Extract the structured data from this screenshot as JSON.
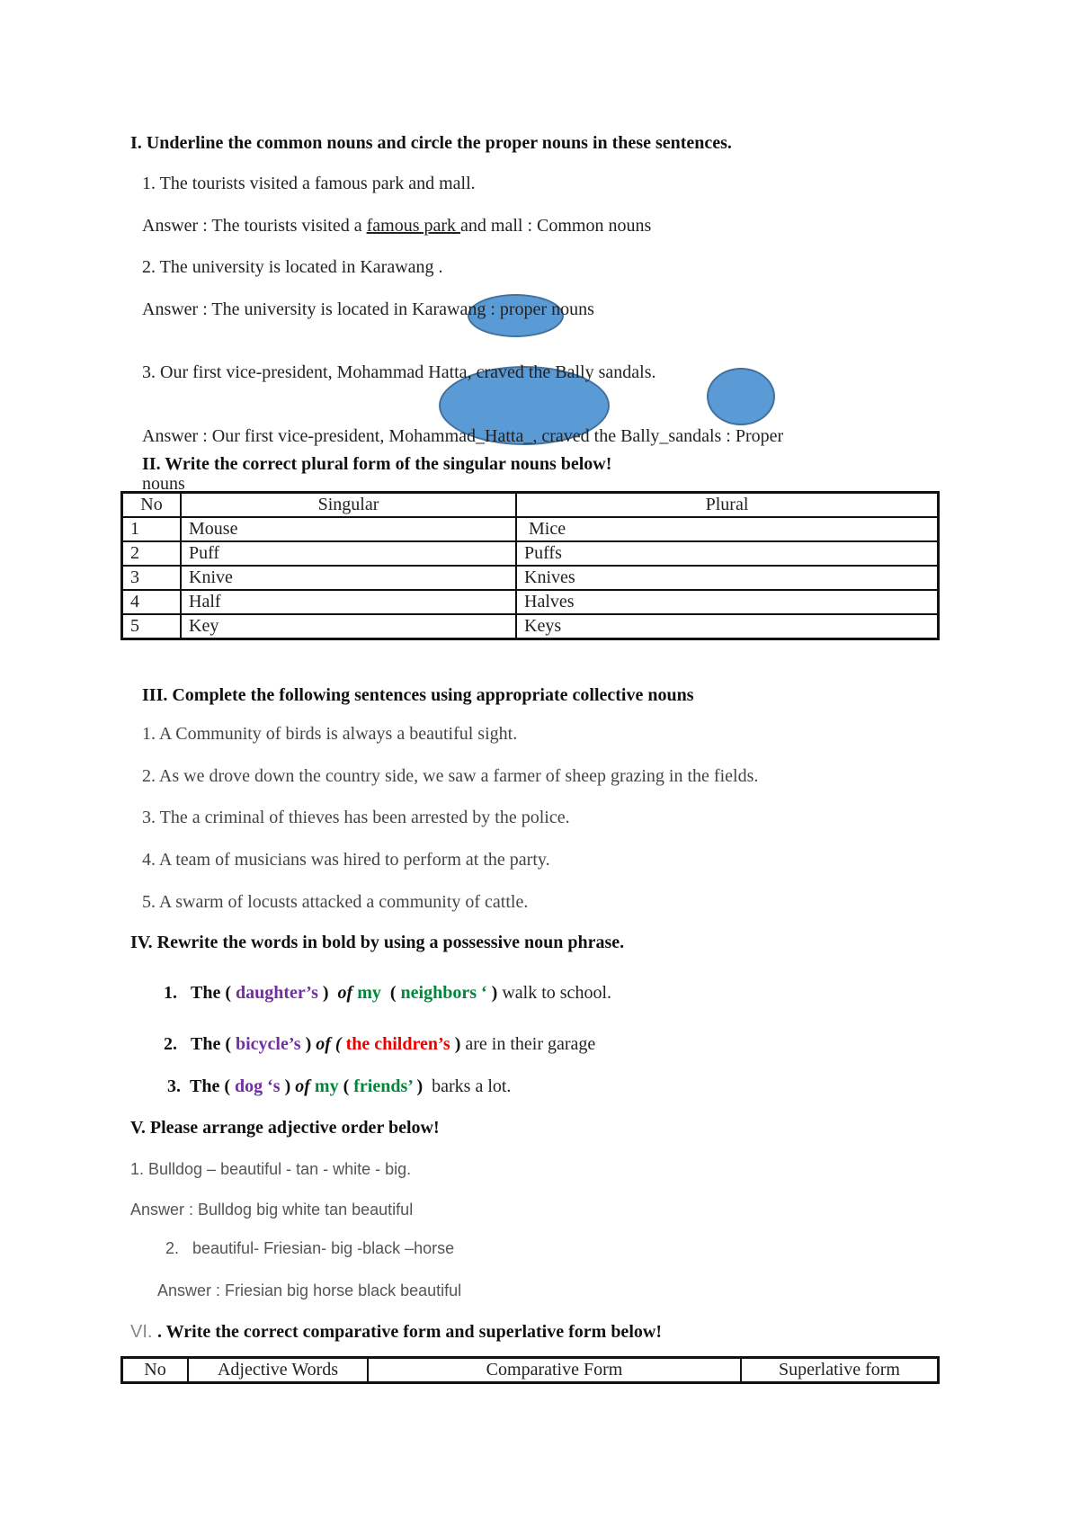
{
  "section1": {
    "heading": "I. Underline  the  common  nouns  and  circle the  proper  nouns  in these  sentences.",
    "q1": "1. The tourists visited a famous park and mall.",
    "a1_prefix": "Answer : The tourists visited a ",
    "a1_underlined": "famous park ",
    "a1_suffix": "and mall : Common nouns",
    "q2": "2. The university is located in Karawang .",
    "a2_prefix": "Answer : The university is located in ",
    "a2_circled": "Karawang",
    "a2_suffix": "   : proper nouns",
    "q3": "3. Our first vice-president, Mohammad Hatta, craved the Bally sandals.",
    "a3_prefix": "Answer : Our first vice-president, ",
    "a3_circled1": "Mohammad_Hatta_",
    "a3_mid": ", craved the ",
    "a3_circled2": "Bally_",
    "a3_suffix": "sandals : Proper",
    "a3_wrap": "nouns"
  },
  "section2": {
    "heading": "II. Write the correct plural form of the singular nouns below!",
    "headers": [
      "No",
      "Singular",
      "Plural"
    ],
    "rows": [
      [
        "1",
        "Mouse",
        " Mice"
      ],
      [
        "2",
        "Puff",
        "Puffs"
      ],
      [
        "3",
        "Knive",
        "Knives"
      ],
      [
        "4",
        "Half",
        "Halves"
      ],
      [
        "5",
        "Key",
        "Keys"
      ]
    ]
  },
  "section3": {
    "heading": "III. Complete the following sentences using appropriate collective nouns",
    "items": [
      "1. A Community  of birds is always a beautiful sight.",
      "2. As we drove down the country side, we saw a farmer of sheep grazing in the fields.",
      "3. The a criminal of thieves has been arrested by the police.",
      "4.  A team  of musicians was hired to perform at the party.",
      "5. A  swarm  of locusts attacked a  community of cattle."
    ]
  },
  "section4": {
    "heading": "IV. Rewrite the words in bold by using a possessive noun phrase.",
    "items": [
      {
        "num": "1.",
        "the": "The (",
        "w1": " daughter’s",
        "p1": " )",
        "of": "of",
        "w2": " my",
        "p2": "  (",
        "w3": " neighbors ‘",
        "p3": " )",
        "rest": " walk to school."
      },
      {
        "num": "2.",
        "the": "The (",
        "w1": " bicycle’s",
        "p1": " )",
        "of": "of (",
        "w2": "",
        "p2": "",
        "w3": " the children’s",
        "p3": " )",
        "rest": " are in their garage"
      },
      {
        "num": "3.",
        "the": "The (",
        "w1": " dog ‘s",
        "p1": " )",
        "of": "of",
        "w2": " my",
        "p2": " (",
        "w3": " friends’",
        "p3": " )",
        "rest": "  barks a lot."
      }
    ]
  },
  "section5": {
    "heading": "V. Please arrange adjective order below!",
    "q1": "1. Bulldog – beautiful  - tan -  white  - big.",
    "a1": "Answer : Bulldog big white tan beautiful",
    "q2": "2.   beautiful- Friesian- big -black –horse",
    "a2": "Answer : Friesian big horse black beautiful"
  },
  "section6": {
    "prefix": "VI. ",
    "heading": ". Write the correct comparative form and superlative form below!",
    "headers": [
      "No",
      "Adjective Words",
      "Comparative Form",
      "Superlative form"
    ]
  },
  "colors": {
    "circle_fill": "#5b9bd5",
    "circle_stroke": "#41719c",
    "purple": "#7030a0",
    "green": "#00883a",
    "red": "#ee0000"
  }
}
